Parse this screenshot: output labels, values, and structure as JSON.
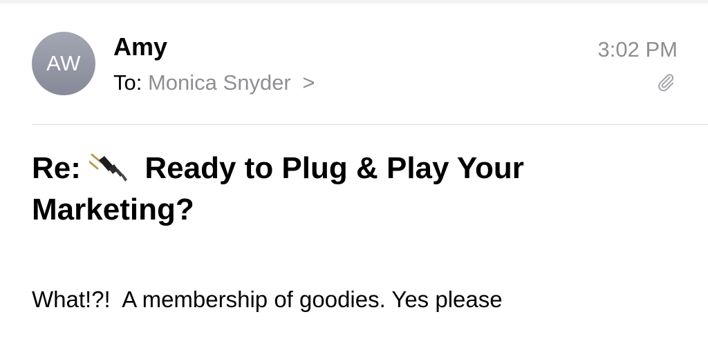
{
  "message": {
    "sender_name": "Amy",
    "avatar_initials": "AW",
    "to_label": "To:",
    "recipient": "Monica Snyder",
    "chevron": ">",
    "time": "3:02 PM",
    "has_attachment_icon": "paperclip-icon",
    "subject_prefix": "Re:",
    "subject_emoji_icon": "electric-plug-icon",
    "subject_text": "Ready to Plug & Play Your Marketing?",
    "body": "What!?!  A membership of goodies. Yes please"
  },
  "colors": {
    "secondary_text": "#8e8e93",
    "divider": "#d8d8dc",
    "avatar": "#9a9ea9"
  }
}
